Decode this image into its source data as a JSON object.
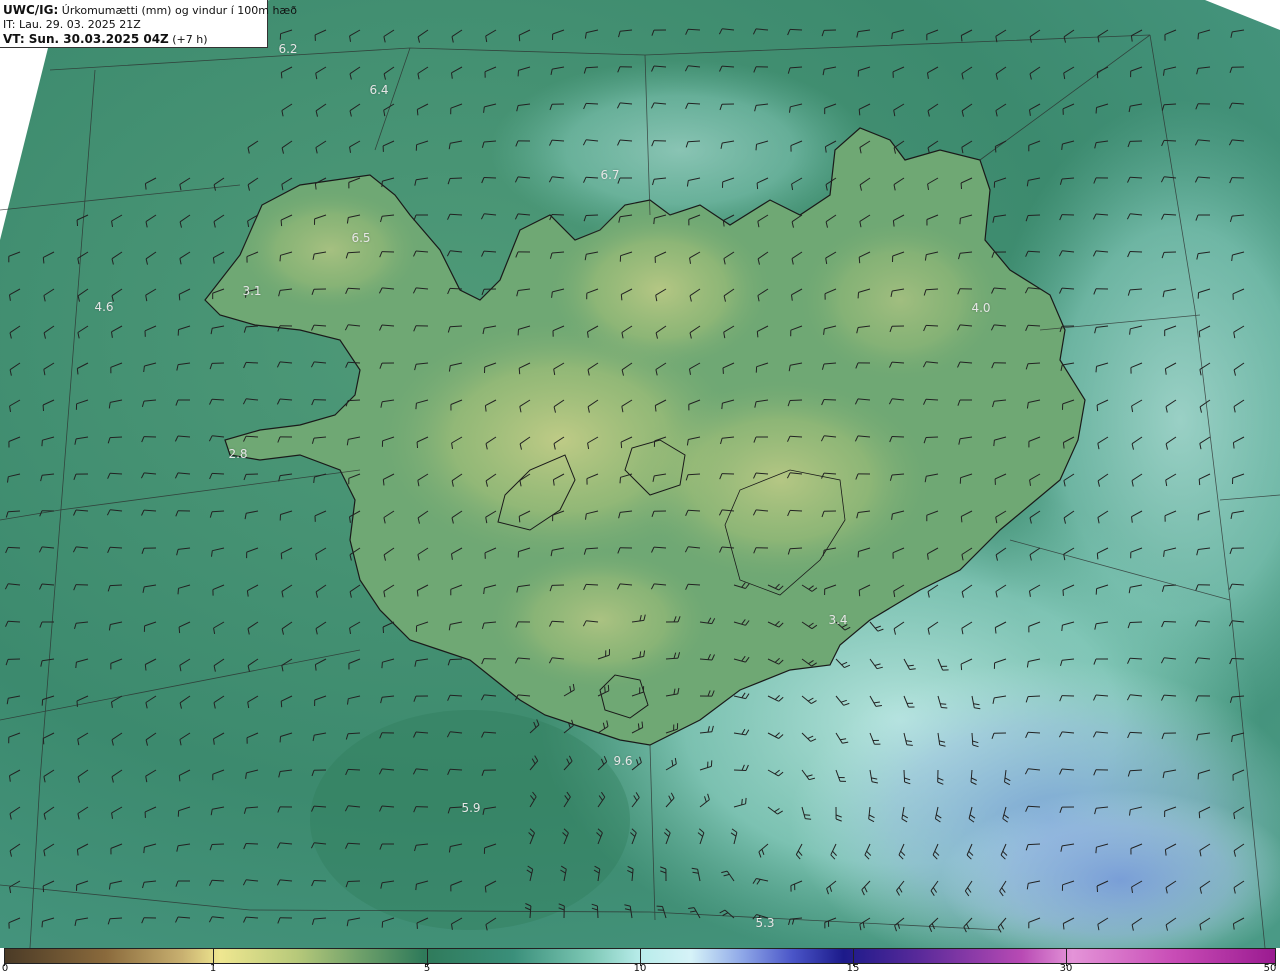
{
  "header": {
    "line1_bold": "UWC/IG:",
    "line1_rest": " Úrkomumætti (mm) og vindur í 100m hæð",
    "line2": "IT: Lau. 29. 03. 2025 21Z",
    "line3_bold": "VT: Sun. 30.03.2025 04Z",
    "line3_rest": " (+7 h)"
  },
  "value_labels": [
    "6.2",
    "6.4",
    "6.7",
    "6.5",
    "3.1",
    "4.6",
    "4.0",
    "2.8",
    "3.4",
    "9.6",
    "5.9",
    "5.3"
  ],
  "colorbar": {
    "ticks": [
      "0",
      "1",
      "5",
      "10",
      "15",
      "30",
      "50"
    ]
  },
  "colors": {
    "land_high": "#d8d68c",
    "land_mid": "#7fae76",
    "sea_green": "#3f8a6e",
    "sea_light": "#a8e6e2",
    "sea_blue": "#6c8ed8",
    "coast": "#1a1a1a"
  }
}
